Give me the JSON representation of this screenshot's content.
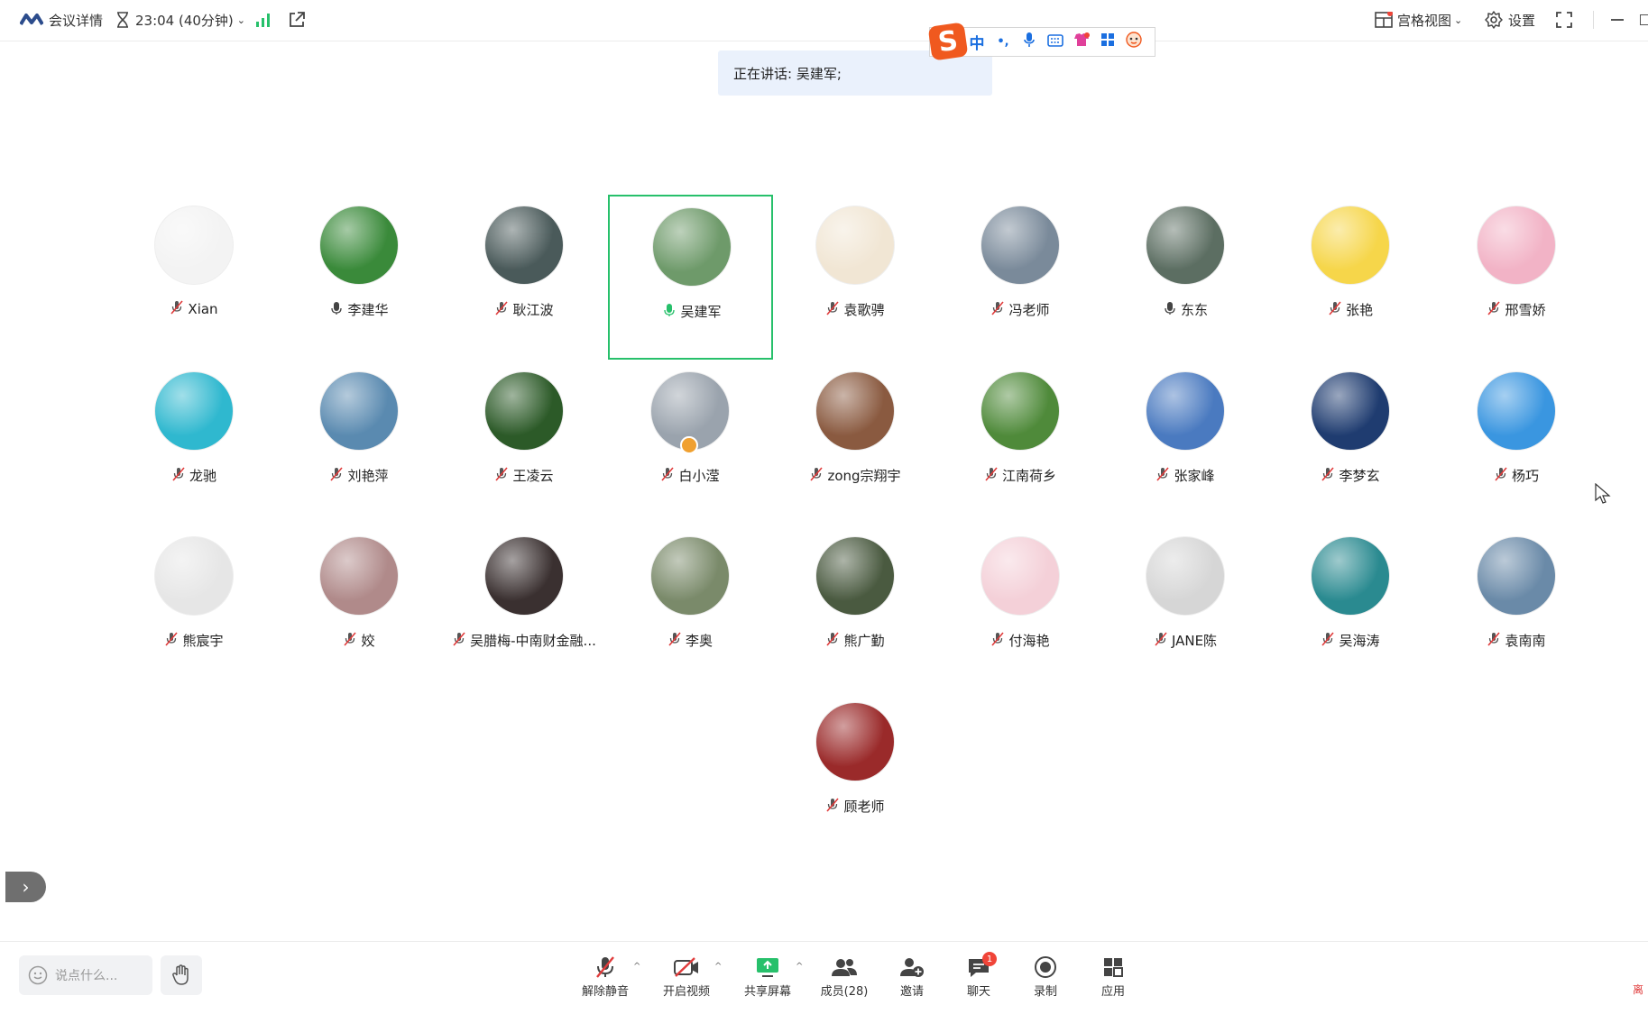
{
  "topbar": {
    "meeting_details": "会议详情",
    "timer": "23:04 (40分钟)",
    "view_mode": "宫格视图",
    "settings": "设置"
  },
  "speaking_banner": "正在讲话: 吴建军;",
  "ime_toolbar": {
    "mode": "中",
    "punct": "•,"
  },
  "participants": [
    {
      "name": "Xian",
      "mic": "muted",
      "avatar_color": "#f3f3f3"
    },
    {
      "name": "李建华",
      "mic": "on",
      "avatar_color": "#3a8a3a"
    },
    {
      "name": "耿江波",
      "mic": "muted",
      "avatar_color": "#4a5a5a"
    },
    {
      "name": "吴建军",
      "mic": "speaking",
      "avatar_color": "#6e9a6a",
      "active": true
    },
    {
      "name": "袁歌骋",
      "mic": "muted",
      "avatar_color": "#f1e6d4"
    },
    {
      "name": "冯老师",
      "mic": "muted",
      "avatar_color": "#7a8a9a"
    },
    {
      "name": "东东",
      "mic": "on",
      "avatar_color": "#5c6e62"
    },
    {
      "name": "张艳",
      "mic": "muted",
      "avatar_color": "#f6d64a"
    },
    {
      "name": "邢雪娇",
      "mic": "muted",
      "avatar_color": "#f2b3c6"
    },
    {
      "name": "龙驰",
      "mic": "muted",
      "avatar_color": "#2fb8cf"
    },
    {
      "name": "刘艳萍",
      "mic": "muted",
      "avatar_color": "#5a8ab0"
    },
    {
      "name": "王凌云",
      "mic": "muted",
      "avatar_color": "#2c5a28"
    },
    {
      "name": "白小滢",
      "mic": "muted",
      "avatar_color": "#9aa3ad",
      "host": true
    },
    {
      "name": "zong宗翔宇",
      "mic": "muted",
      "avatar_color": "#8a5a40"
    },
    {
      "name": "江南荷乡",
      "mic": "muted",
      "avatar_color": "#4f8a3a"
    },
    {
      "name": "张家峰",
      "mic": "muted",
      "avatar_color": "#4a7ac0"
    },
    {
      "name": "李梦玄",
      "mic": "muted",
      "avatar_color": "#1f3c70"
    },
    {
      "name": "杨巧",
      "mic": "muted",
      "avatar_color": "#3a96e0"
    },
    {
      "name": "熊宸宇",
      "mic": "muted",
      "avatar_color": "#e6e6e6"
    },
    {
      "name": "姣",
      "mic": "muted",
      "avatar_color": "#b08a8a"
    },
    {
      "name": "吴腊梅-中南财金融...",
      "mic": "muted",
      "avatar_color": "#3a3030"
    },
    {
      "name": "李奥",
      "mic": "muted",
      "avatar_color": "#7a8a6a"
    },
    {
      "name": "熊广勤",
      "mic": "muted",
      "avatar_color": "#4a5a40"
    },
    {
      "name": "付海艳",
      "mic": "muted",
      "avatar_color": "#f4d0d8"
    },
    {
      "name": "JANE陈",
      "mic": "muted",
      "avatar_color": "#d6d6d6"
    },
    {
      "name": "吴海涛",
      "mic": "muted",
      "avatar_color": "#2a8a90"
    },
    {
      "name": "袁南南",
      "mic": "muted",
      "avatar_color": "#6a8aa8"
    },
    {
      "name": "顾老师",
      "mic": "muted",
      "avatar_color": "#9a2a2a"
    }
  ],
  "bottombar": {
    "chat_placeholder": "说点什么...",
    "unmute": "解除静音",
    "start_video": "开启视频",
    "share_screen": "共享屏幕",
    "members": "成员(28)",
    "invite": "邀请",
    "chat": "聊天",
    "chat_badge": "1",
    "record": "录制",
    "apps": "应用"
  },
  "corner_text": "离",
  "colors": {
    "accent_green": "#27c06b",
    "banner_bg": "#eaf1fc",
    "badge_red": "#f04438"
  }
}
